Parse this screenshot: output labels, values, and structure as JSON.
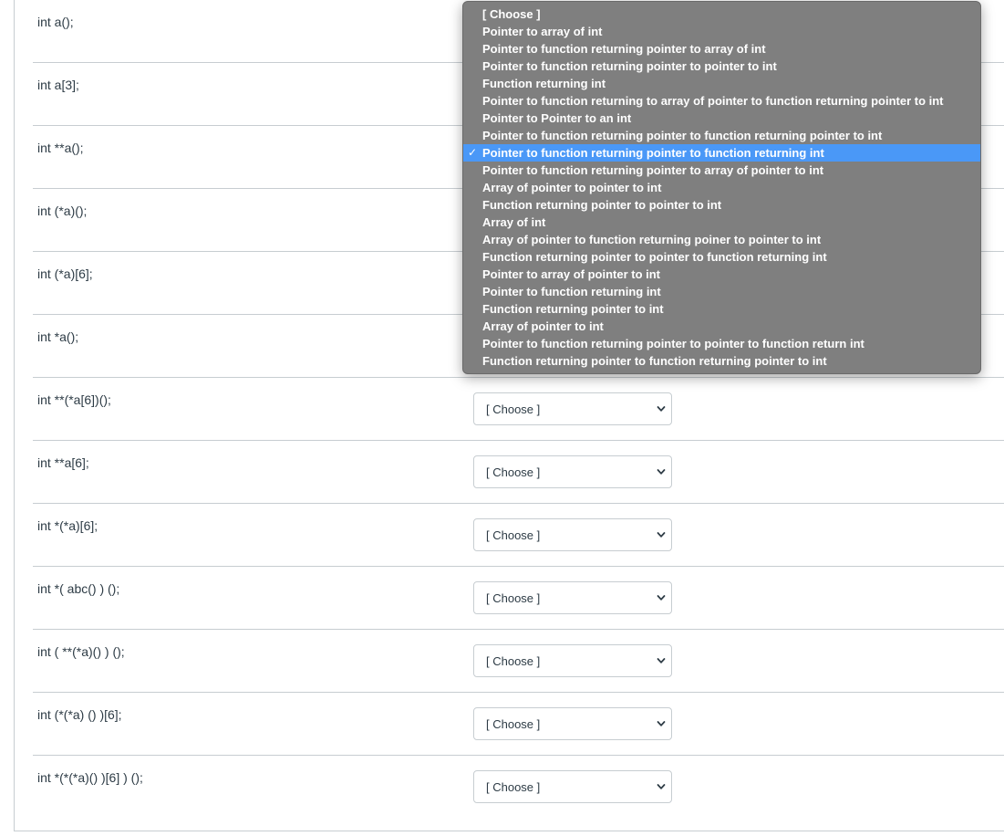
{
  "rows": [
    {
      "declaration": "int a();",
      "selected": "[ Choose ]"
    },
    {
      "declaration": "int a[3];",
      "selected": "[ Choose ]"
    },
    {
      "declaration": "int **a();",
      "selected": "[ Choose ]"
    },
    {
      "declaration": "int (*a)();",
      "selected": "[ Choose ]"
    },
    {
      "declaration": "int (*a)[6];",
      "selected": "[ Choose ]"
    },
    {
      "declaration": "int *a();",
      "selected": "[ Choose ]"
    },
    {
      "declaration": "int **(*a[6])();",
      "selected": "[ Choose ]"
    },
    {
      "declaration": "int **a[6];",
      "selected": "[ Choose ]"
    },
    {
      "declaration": "int *(*a)[6];",
      "selected": "[ Choose ]"
    },
    {
      "declaration": "int *( abc() ) ();",
      "selected": "[ Choose ]"
    },
    {
      "declaration": "int ( **(*a)() ) ();",
      "selected": "[ Choose ]"
    },
    {
      "declaration": "int (*(*a) () )[6];",
      "selected": "[ Choose ]"
    },
    {
      "declaration": "int *(*(*a)() )[6] ) ();",
      "selected": "[ Choose ]"
    }
  ],
  "dropdown": {
    "checkmark": "✓",
    "highlighted_index": 8,
    "options": [
      "[ Choose ]",
      "Pointer to array of int",
      "Pointer to function returning pointer to array of int",
      "Pointer to function returning pointer to pointer to int",
      "Function returning int",
      "Pointer to function returning to array of pointer to function returning pointer to int",
      "Pointer to Pointer to an int",
      "Pointer to function returning pointer to function returning pointer to int",
      "Pointer to function returning pointer to function returning int",
      "Pointer to function returning pointer to array of pointer to int",
      "Array of pointer to pointer to int",
      "Function returning pointer to pointer to int",
      "Array of int",
      "Array of pointer to function returning poiner to pointer to int",
      "Function returning pointer to pointer to function returning int",
      "Pointer to array of pointer to int",
      "Pointer to function returning int",
      "Function returning pointer to int",
      "Array of pointer to int",
      "Pointer to function returning pointer to pointer to function return int",
      "Function returning pointer to function returning pointer to int"
    ]
  },
  "colors": {
    "text": "#2d3b45",
    "divider": "#c7cdd1",
    "dropdown_bg": "#7f7f7f",
    "highlight": "#4a98f7"
  }
}
